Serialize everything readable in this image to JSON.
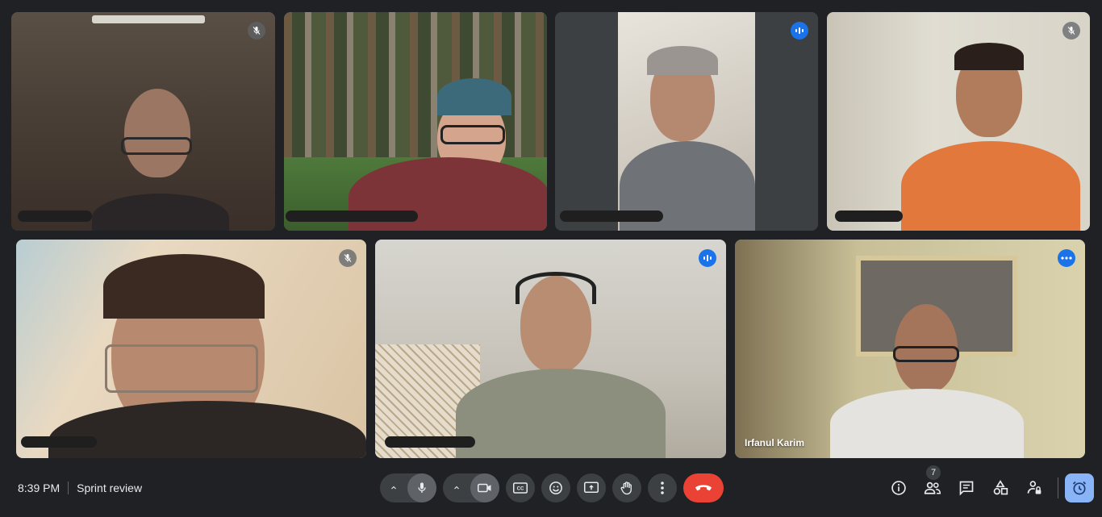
{
  "meeting": {
    "time": "8:39 PM",
    "separator": "|",
    "title": "Sprint review"
  },
  "participants": [
    {
      "id": "p1",
      "name": "",
      "status": "muted"
    },
    {
      "id": "p2",
      "name": "",
      "status": "none"
    },
    {
      "id": "p3",
      "name": "",
      "status": "speaking"
    },
    {
      "id": "p4",
      "name": "",
      "status": "muted"
    },
    {
      "id": "p5",
      "name": "",
      "status": "muted"
    },
    {
      "id": "p6",
      "name": "",
      "status": "speaking"
    },
    {
      "id": "p7",
      "name": "Irfanul Karim",
      "status": "more-options"
    }
  ],
  "controls": {
    "mic_options": "chevron-up-icon",
    "mic": "microphone-icon",
    "cam_options": "chevron-up-icon",
    "camera": "camera-icon",
    "captions": "closed-captions-icon",
    "emoji": "emoji-icon",
    "present": "present-screen-icon",
    "raise_hand": "hand-icon",
    "more": "more-vert-icon",
    "leave": "end-call-icon"
  },
  "right_panel": {
    "info": "info-icon",
    "people": "people-icon",
    "people_count": "7",
    "chat": "chat-icon",
    "activities": "shapes-icon",
    "host_controls": "lock-person-icon",
    "timer": "alarm-icon"
  },
  "colors": {
    "background": "#202124",
    "button": "#3c4043",
    "end_call": "#ea4335",
    "accent": "#8ab4f8",
    "speaking": "#1a73e8"
  }
}
